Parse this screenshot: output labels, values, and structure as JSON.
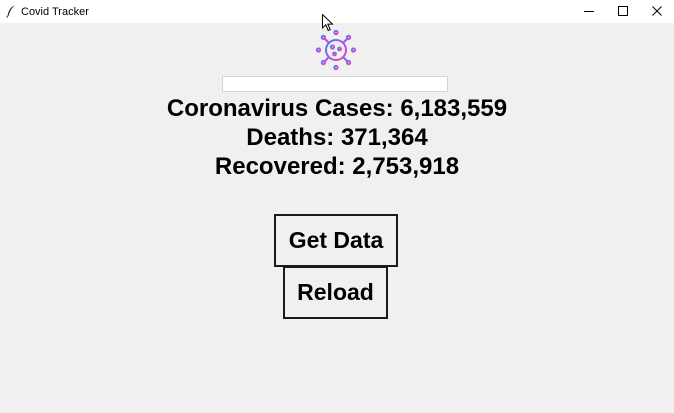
{
  "window": {
    "title": "Covid Tracker",
    "controls": {
      "minimize": "minimize-icon",
      "maximize": "maximize-icon",
      "close": "close-icon"
    }
  },
  "main": {
    "logo_icon": "virus-icon",
    "logo_gradient": [
      "#3b82f6",
      "#a855f7",
      "#ec4899"
    ],
    "country_input": {
      "value": "",
      "placeholder": ""
    },
    "stats": {
      "cases": "Coronavirus Cases: 6,183,559",
      "deaths": "Deaths: 371,364",
      "recovered": "Recovered: 2,753,918"
    },
    "buttons": {
      "get_data": "Get Data",
      "reload": "Reload"
    }
  }
}
